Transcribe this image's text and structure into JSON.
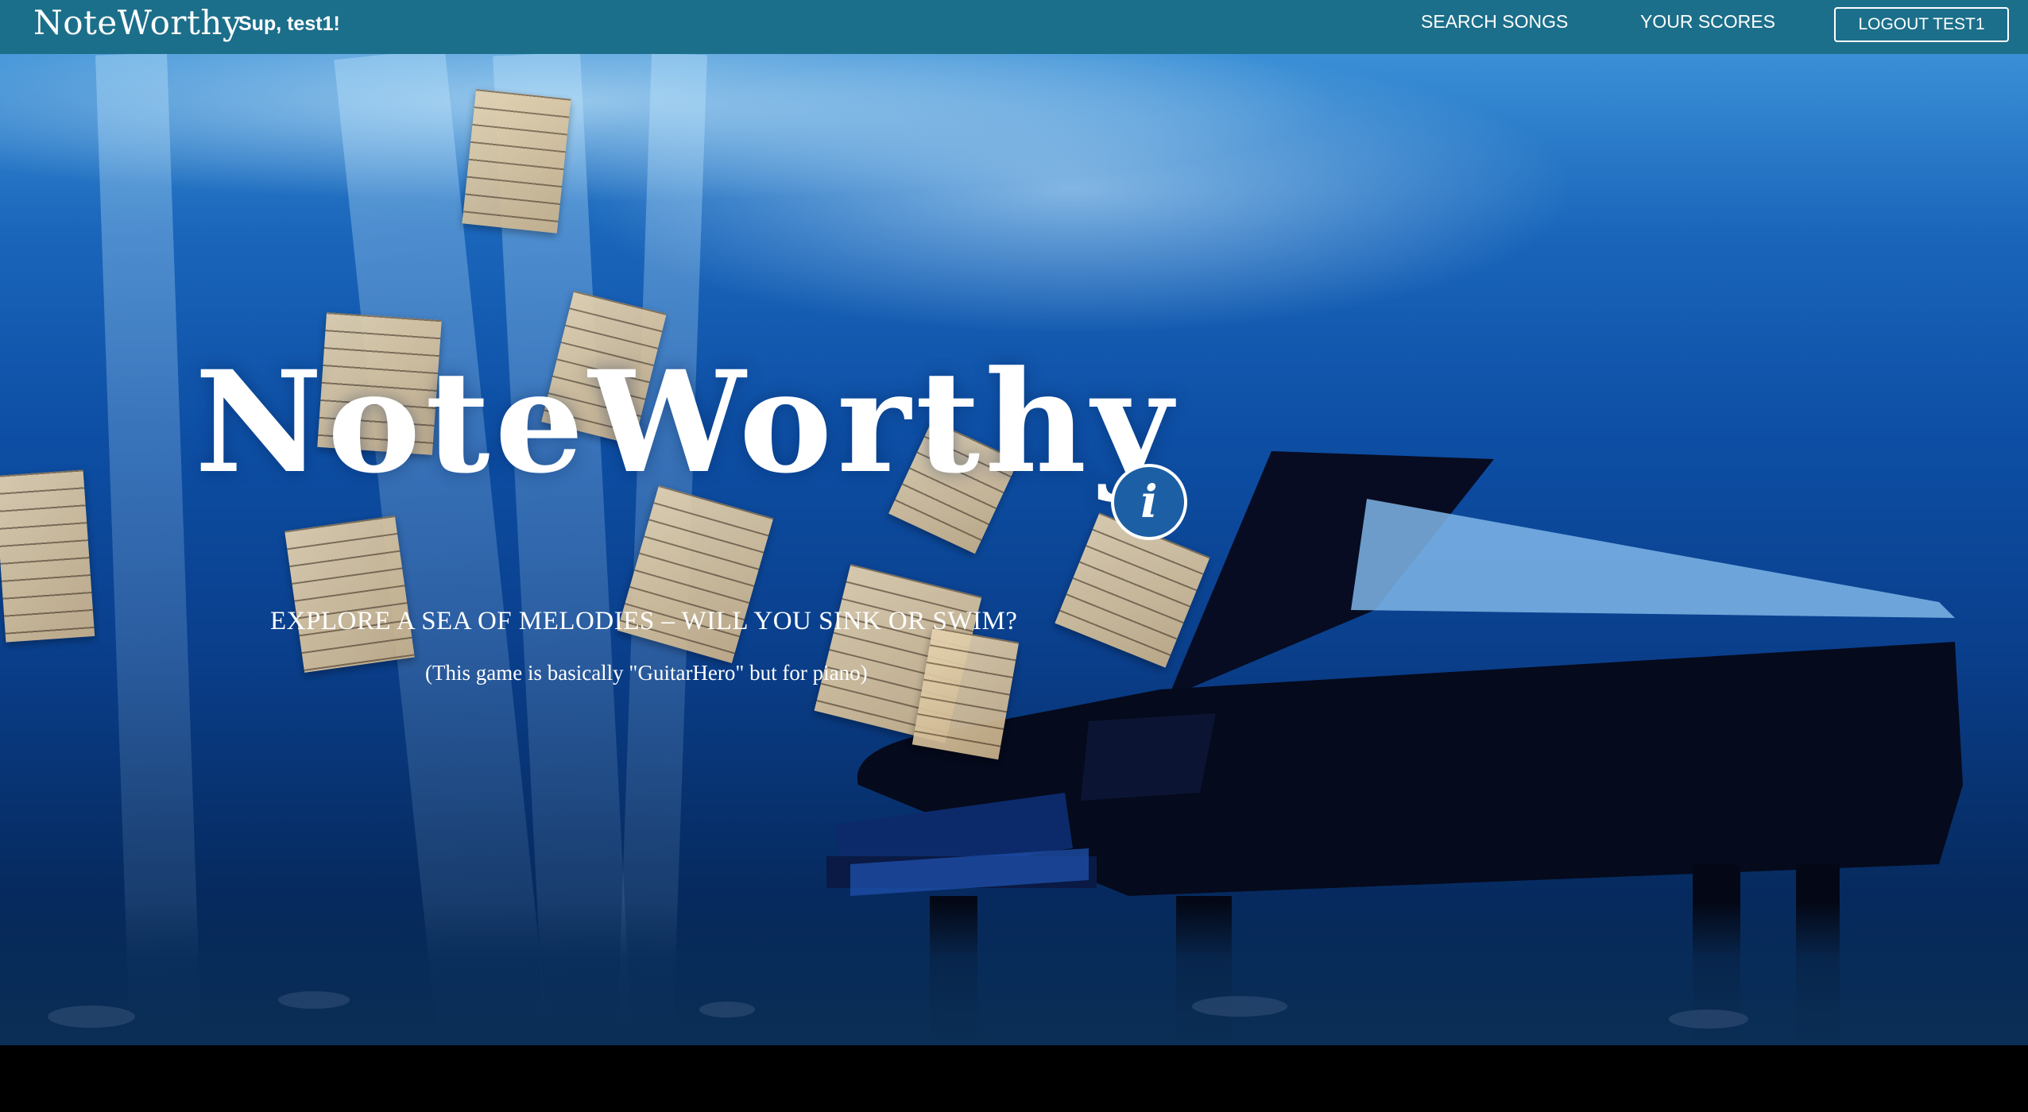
{
  "navbar": {
    "brand": "NoteWorthy",
    "greeting": "Sup, test1!",
    "links": [
      {
        "label": "SEARCH SONGS"
      },
      {
        "label": "YOUR SCORES"
      }
    ],
    "logout_label": "LOGOUT TEST1",
    "background_color": "#1c6f8a"
  },
  "hero": {
    "title": "NoteWorthy",
    "info_icon": "info-icon",
    "info_glyph": "i",
    "tagline": "EXPLORE A SEA OF MELODIES – WILL YOU SINK OR SWIM?",
    "subline": "(This game is basically \"GuitarHero\" but for piano)",
    "background_image": "underwater scene with grand piano and floating sheet music"
  }
}
